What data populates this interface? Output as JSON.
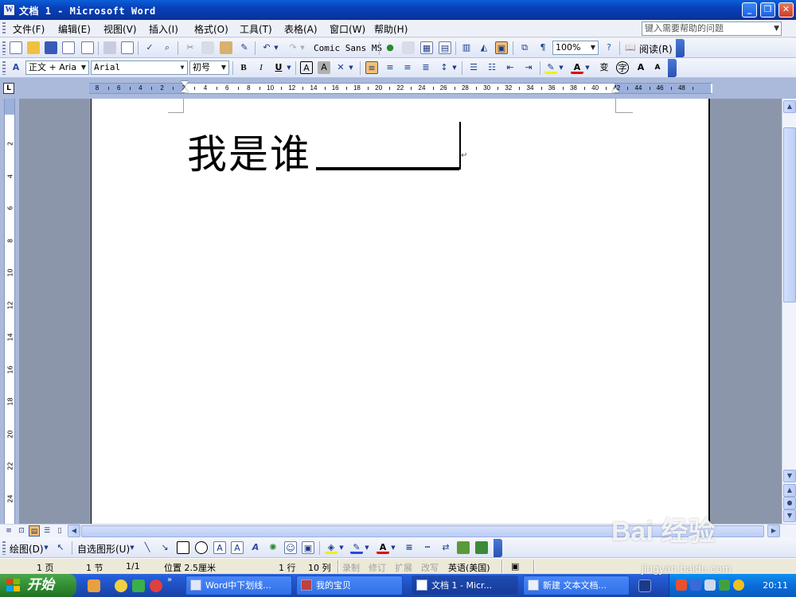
{
  "titlebar": {
    "title": "文档 1 - Microsoft Word",
    "app_icon": "W",
    "minimize": "_",
    "restore": "❐",
    "close": "✕"
  },
  "menubar": {
    "items": [
      {
        "label": "文件(F)"
      },
      {
        "label": "编辑(E)"
      },
      {
        "label": "视图(V)"
      },
      {
        "label": "插入(I)"
      },
      {
        "label": "格式(O)"
      },
      {
        "label": "工具(T)"
      },
      {
        "label": "表格(A)"
      },
      {
        "label": "窗口(W)"
      },
      {
        "label": "帮助(H)"
      }
    ],
    "help_placeholder": "键入需要帮助的问题"
  },
  "standard_toolbar": {
    "font_preview": "Comic Sans MS",
    "zoom": "100%",
    "read_label": "阅读(R)"
  },
  "format_toolbar": {
    "style": "正文 + Aria",
    "font": "Arial",
    "size": "初号",
    "bold": "B",
    "italic": "I",
    "underline": "U",
    "char_border": "A",
    "char_shading": "A",
    "font_color": "A",
    "grow": "A",
    "shrink": "A",
    "phonetic": "变",
    "enclose": "字"
  },
  "ruler": {
    "corner": "L",
    "ticks": [
      "8",
      "6",
      "4",
      "2",
      "2",
      "4",
      "6",
      "8",
      "10",
      "12",
      "14",
      "16",
      "18",
      "20",
      "22",
      "24",
      "26",
      "28",
      "30",
      "32",
      "34",
      "36",
      "38",
      "40",
      "42",
      "44",
      "46",
      "48"
    ],
    "vticks": [
      "2",
      "4",
      "6",
      "8",
      "10",
      "12",
      "14",
      "16",
      "18",
      "20",
      "22",
      "24"
    ]
  },
  "document": {
    "text": "我是谁",
    "para_mark": "↵"
  },
  "drawing_toolbar": {
    "draw_label": "绘图(D)",
    "autoshape_label": "自选图形(U)"
  },
  "statusbar": {
    "page": "1 页",
    "section": "1 节",
    "pages": "1/1",
    "position": "位置 2.5厘米",
    "line": "1 行",
    "column": "10 列",
    "rec": "录制",
    "trk": "修订",
    "ext": "扩展",
    "ovr": "改写",
    "lang": "英语(美国)"
  },
  "taskbar": {
    "start": "开始",
    "tasks": [
      {
        "label": "Word中下划线..."
      },
      {
        "label": "我的宝贝"
      },
      {
        "label": "文档 1 - Micr..."
      },
      {
        "label": "新建 文本文档..."
      }
    ],
    "clock": "20:11"
  },
  "watermark": {
    "brand": "Bai 经验",
    "url": "jingyan.baidu.com"
  },
  "colors": {
    "titlebar": "#0840b8",
    "toolbar": "#dfe6f6",
    "ruler_bg": "#abbadb",
    "doc_bg": "#8c96ab",
    "taskbar": "#245edb",
    "start": "#2f8a2f",
    "tray": "#0a6cd8"
  }
}
